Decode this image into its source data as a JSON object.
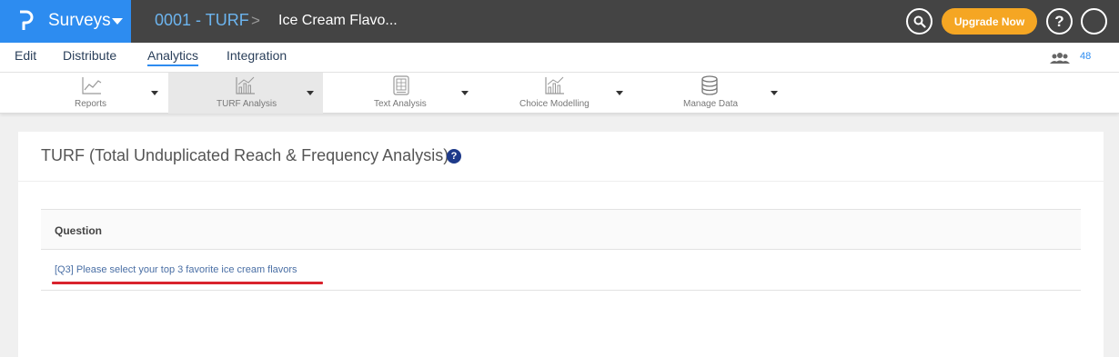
{
  "header": {
    "brand": "Surveys",
    "survey_crumb": "0001 - TURF",
    "separator": ">",
    "survey_title": "Ice Cream Flavo...",
    "upgrade_label": "Upgrade Now",
    "help_label": "?"
  },
  "subnav": {
    "items": [
      "Edit",
      "Distribute",
      "Analytics",
      "Integration"
    ],
    "active": "Analytics",
    "user_count": "48"
  },
  "toolbar": {
    "items": [
      {
        "label": "Reports",
        "icon": "line-chart-icon"
      },
      {
        "label": "TURF Analysis",
        "icon": "bar-trend-chart-icon"
      },
      {
        "label": "Text Analysis",
        "icon": "document-grid-icon"
      },
      {
        "label": "Choice Modelling",
        "icon": "bar-trend-chart-icon"
      },
      {
        "label": "Manage Data",
        "icon": "database-icon"
      }
    ],
    "active": "TURF Analysis"
  },
  "main": {
    "title": "TURF (Total Unduplicated Reach & Frequency Analysis)",
    "help_label": "?",
    "table": {
      "header": "Question",
      "rows": [
        "[Q3] Please select your top 3 favorite ice cream flavors"
      ]
    }
  },
  "colors": {
    "topbar": "#444444",
    "brand": "#2d8cf0",
    "upgrade": "#f5a623",
    "highlight_underline": "#d9232d"
  }
}
